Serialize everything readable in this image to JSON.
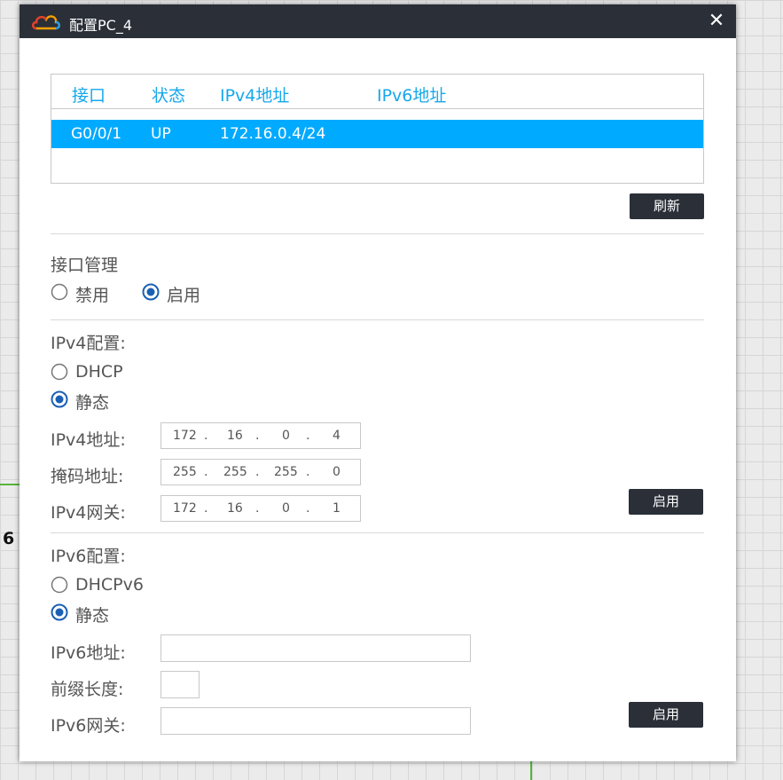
{
  "dialog": {
    "title": "配置PC_4",
    "close_label": "✕"
  },
  "interfaces": {
    "columns": [
      "接口",
      "状态",
      "IPv4地址",
      "IPv6地址"
    ],
    "rows": [
      {
        "interface": "G0/0/1",
        "status": "UP",
        "ipv4": "172.16.0.4/24",
        "ipv6": ""
      }
    ],
    "refresh_label": "刷新"
  },
  "interface_mgmt": {
    "title": "接口管理",
    "options": [
      "禁用",
      "启用"
    ],
    "selected": "启用"
  },
  "ipv4": {
    "title": "IPv4配置:",
    "modes": [
      "DHCP",
      "静态"
    ],
    "selected_mode": "静态",
    "address_label": "IPv4地址:",
    "address": [
      "172",
      "16",
      "0",
      "4"
    ],
    "mask_label": "掩码地址:",
    "mask": [
      "255",
      "255",
      "255",
      "0"
    ],
    "gateway_label": "IPv4网关:",
    "gateway": [
      "172",
      "16",
      "0",
      "1"
    ],
    "apply_label": "启用"
  },
  "ipv6": {
    "title": "IPv6配置:",
    "modes": [
      "DHCPv6",
      "静态"
    ],
    "selected_mode": "静态",
    "address_label": "IPv6地址:",
    "address": "",
    "prefix_label": "前缀长度:",
    "prefix": "",
    "gateway_label": "IPv6网关:",
    "gateway": "",
    "apply_label": "启用"
  },
  "canvas": {
    "partial_label": "6",
    "link_color": "#55b53a"
  },
  "colors": {
    "accent": "#00aaff",
    "header_text": "#17a7ea",
    "titlebar": "#2a2f38",
    "radio_selected": "#1a5fb4"
  }
}
